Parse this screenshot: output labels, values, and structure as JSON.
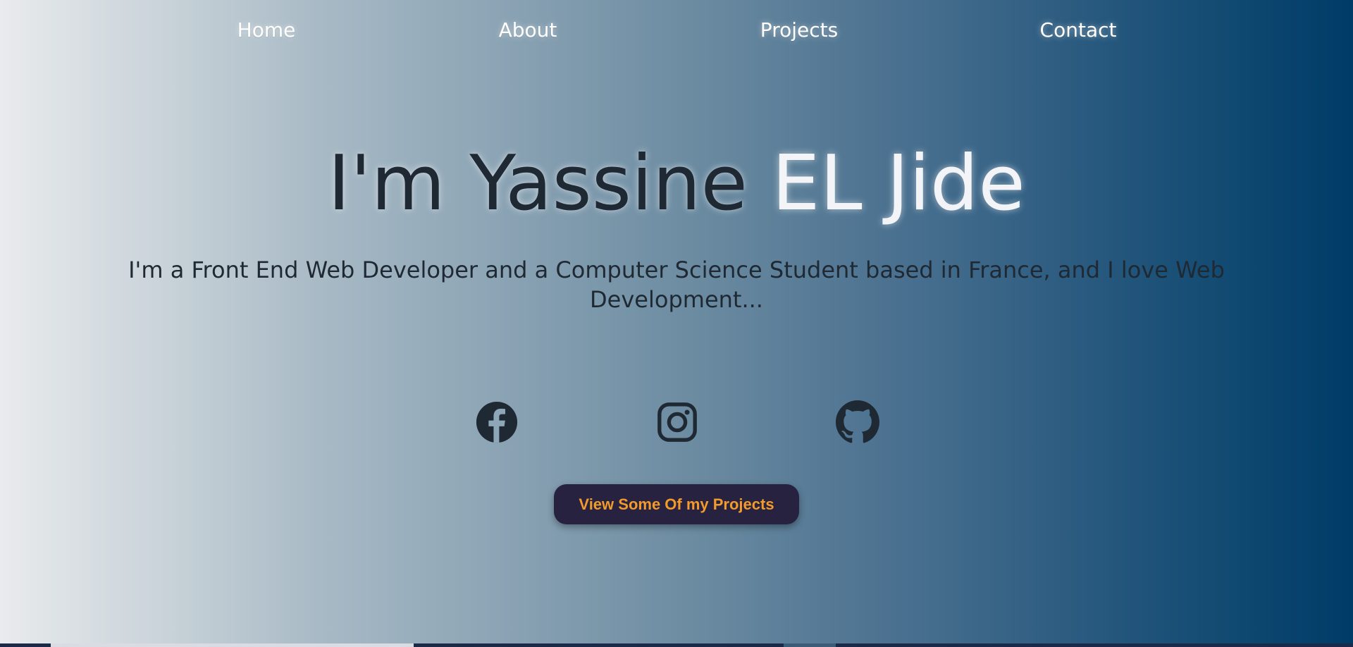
{
  "nav": {
    "items": [
      {
        "label": "Home"
      },
      {
        "label": "About"
      },
      {
        "label": "Projects"
      },
      {
        "label": "Contact"
      }
    ]
  },
  "hero": {
    "title_dark": "I'm Yassine ",
    "title_light": "EL Jide",
    "subtitle": "I'm a Front End Web Developer and a Computer Science Student based in France, and I love Web Development..."
  },
  "social": {
    "icons": [
      "facebook-icon",
      "instagram-icon",
      "github-icon"
    ],
    "icon_color": "#1f2933"
  },
  "cta": {
    "label": "View Some Of my Projects",
    "background": "#26223f",
    "text_color": "#f39a2a"
  },
  "colors": {
    "gradient_start": "#e9ebed",
    "gradient_end": "#003b68",
    "title_dark": "#1f2933",
    "title_light": "#f2f4f7"
  }
}
